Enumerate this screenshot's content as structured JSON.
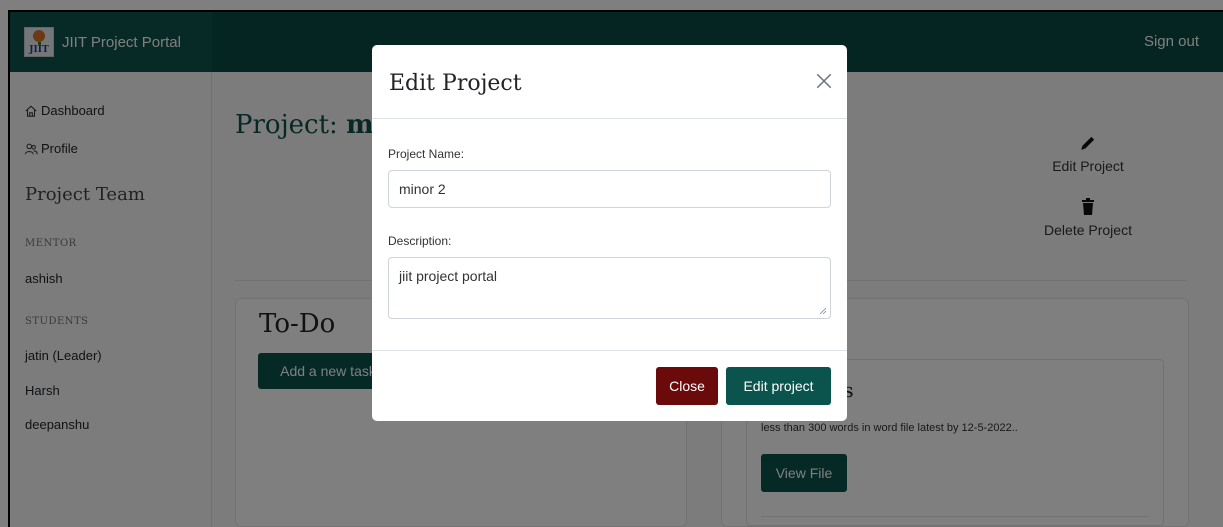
{
  "app": {
    "brand": "JIIT Project Portal",
    "logo_text": "JIIT",
    "sign_out": "Sign out"
  },
  "sidebar": {
    "links": [
      {
        "label": "Dashboard",
        "icon": "house-icon"
      },
      {
        "label": "Profile",
        "icon": "people-icon"
      }
    ],
    "team_heading": "Project Team",
    "mentor_heading": "MENTOR",
    "mentor": "ashish",
    "students_heading": "STUDENTS",
    "students": [
      "jatin (Leader)",
      "Harsh",
      "deepanshu"
    ]
  },
  "main": {
    "title_prefix": "Project: ",
    "title_name": "m",
    "edit_project": "Edit Project",
    "delete_project": "Delete Project",
    "todo_title": "To-Do",
    "add_task": "Add a new task",
    "right_card_title_fragment": "is",
    "task_description": "less than 300 words in word file latest by 12-5-2022..",
    "view_file": "View File"
  },
  "modal": {
    "title": "Edit Project",
    "project_name_label": "Project Name:",
    "project_name_value": "minor 2",
    "description_label": "Description:",
    "description_value": "jiit project portal",
    "close_button": "Close",
    "submit_button": "Edit project"
  },
  "colors": {
    "navbar": "#0b4a44",
    "brand_bg": "#10544d",
    "accent": "#0b544d",
    "close_button": "#6b0a0a",
    "backdrop": "rgba(0,0,0,0.5)"
  }
}
